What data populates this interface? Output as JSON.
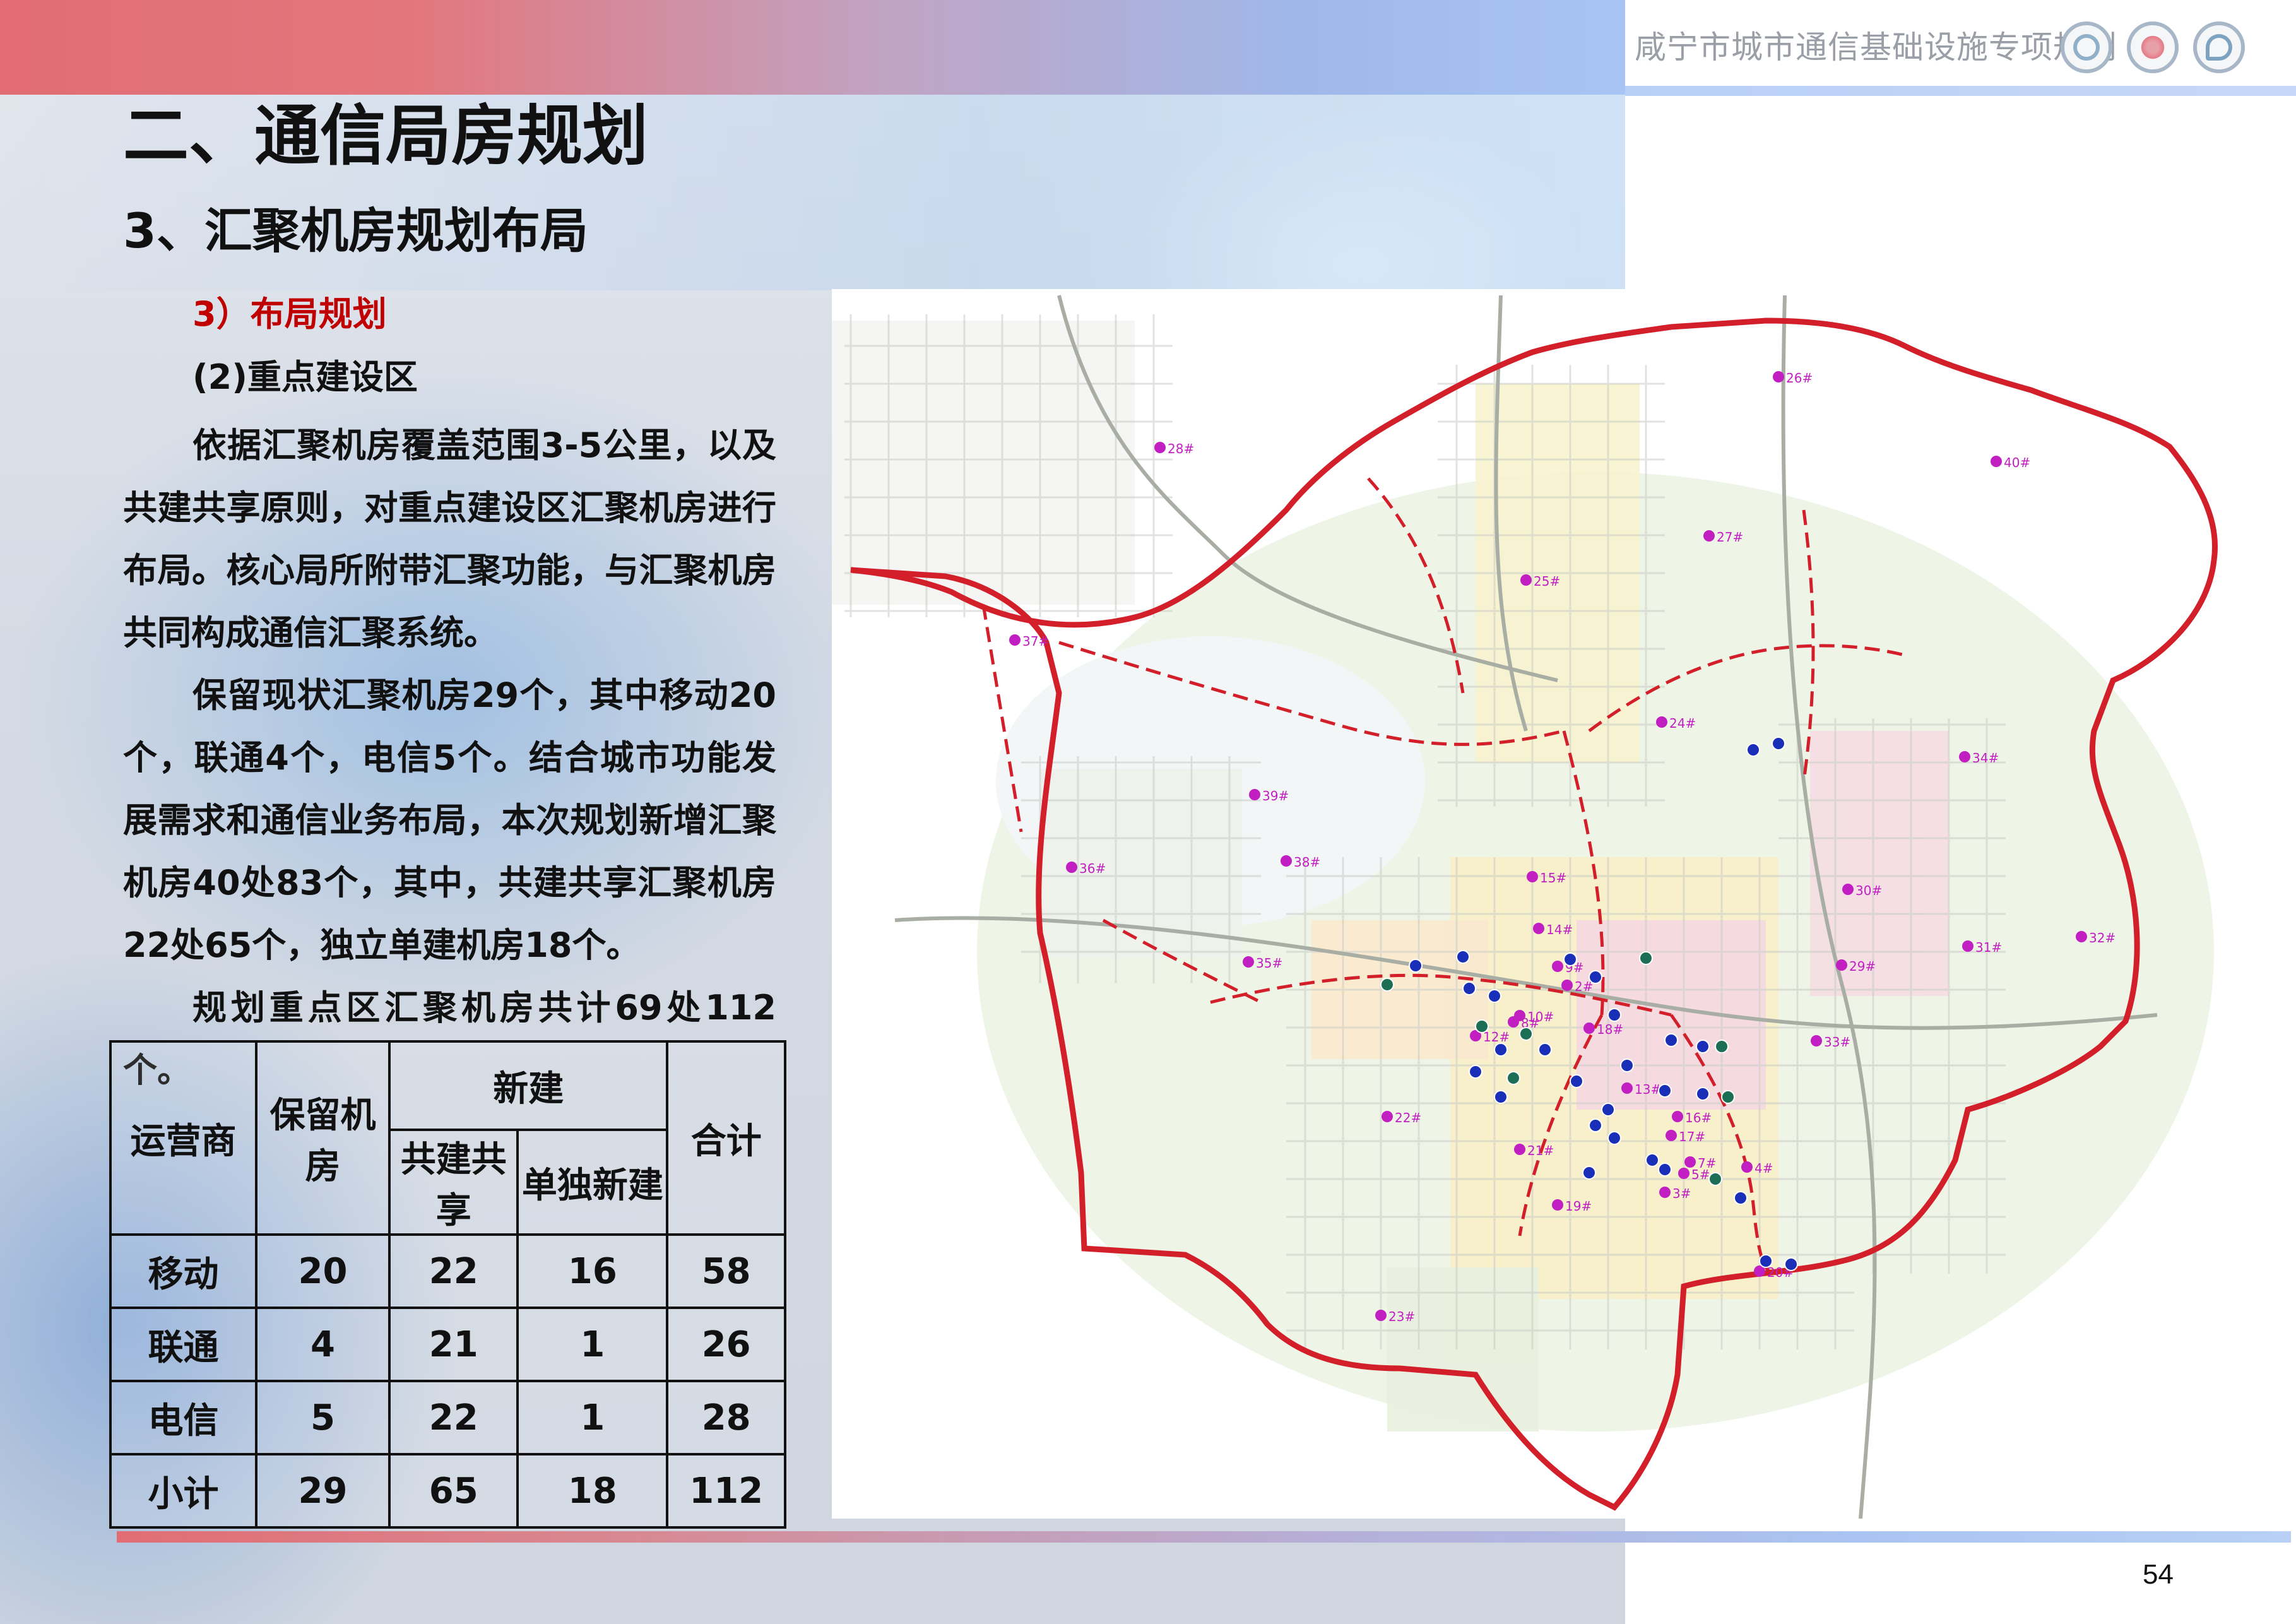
{
  "header": {
    "brand_title": "咸宁市城市通信基础设施专项规划",
    "logos": [
      "china-mobile-logo",
      "china-unicom-logo",
      "china-telecom-logo"
    ]
  },
  "title": "二、通信局房规划",
  "section": "3、汇聚机房规划布局",
  "subsection": "3）布局规划",
  "subsubsection": "(2)重点建设区",
  "paragraphs": [
    "依据汇聚机房覆盖范围3-5公里，以及共建共享原则，对重点建设区汇聚机房进行布局。核心局所附带汇聚功能，与汇聚机房共同构成通信汇聚系统。",
    "保留现状汇聚机房29个，其中移动20个，联通4个，电信5个。结合城市功能发展需求和通信业务布局，本次规划新增汇聚机房40处83个，其中，共建共享汇聚机房22处65个，独立单建机房18个。",
    "规划重点区汇聚机房共计69处112个。"
  ],
  "table": {
    "headers": {
      "operator": "运营商",
      "retained": "保留机房",
      "new": "新建",
      "shared": "共建共享",
      "standalone": "单独新建",
      "total": "合计"
    },
    "rows": [
      {
        "operator": "移动",
        "retained": "20",
        "shared": "22",
        "standalone": "16",
        "total": "58"
      },
      {
        "operator": "联通",
        "retained": "4",
        "shared": "21",
        "standalone": "1",
        "total": "26"
      },
      {
        "operator": "电信",
        "retained": "5",
        "shared": "22",
        "standalone": "1",
        "total": "28"
      },
      {
        "operator": "小计",
        "retained": "29",
        "shared": "65",
        "standalone": "18",
        "total": "112"
      }
    ]
  },
  "map": {
    "labels": [
      "26#",
      "28#",
      "40#",
      "27#",
      "25#",
      "37#",
      "24#",
      "34#",
      "39#",
      "36#",
      "38#",
      "15#",
      "30#",
      "32#",
      "14#",
      "31#",
      "35#",
      "9#",
      "29#",
      "2#",
      "10#",
      "8#",
      "18#",
      "33#",
      "12#",
      "13#",
      "22#",
      "16#",
      "17#",
      "21#",
      "7#",
      "4#",
      "5#",
      "3#",
      "19#",
      "20#",
      "23#"
    ],
    "colors": {
      "boundary": "#d21f2a",
      "label": "#c21fc2",
      "marker_blue": "#1a2fb8",
      "marker_teal": "#1c6e55"
    }
  },
  "footer": {
    "page_number": "54"
  }
}
